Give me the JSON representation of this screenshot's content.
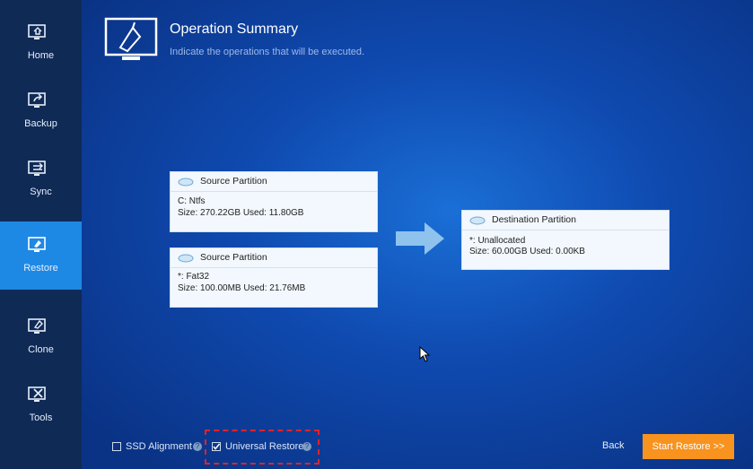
{
  "sidebar": {
    "items": [
      {
        "label": "Home",
        "icon": "home-icon",
        "active": false
      },
      {
        "label": "Backup",
        "icon": "backup-icon",
        "active": false
      },
      {
        "label": "Sync",
        "icon": "sync-icon",
        "active": false
      },
      {
        "label": "Restore",
        "icon": "restore-icon",
        "active": true
      },
      {
        "label": "Clone",
        "icon": "clone-icon",
        "active": false
      },
      {
        "label": "Tools",
        "icon": "tools-icon",
        "active": false
      }
    ]
  },
  "header": {
    "title": "Operation Summary",
    "subtitle": "Indicate the operations that will be executed."
  },
  "sources": [
    {
      "header": "Source Partition",
      "name": "C: Ntfs",
      "size": "Size: 270.22GB  Used: 11.80GB"
    },
    {
      "header": "Source Partition",
      "name": "*: Fat32",
      "size": "Size: 100.00MB  Used: 21.76MB"
    }
  ],
  "destination": {
    "header": "Destination Partition",
    "name": "*: Unallocated",
    "size": "Size: 60.00GB  Used: 0.00KB"
  },
  "options": {
    "ssd_alignment": {
      "label": "SSD Alignment",
      "checked": false
    },
    "universal_restore": {
      "label": "Universal Restore",
      "checked": true
    }
  },
  "footer": {
    "back_label": "Back",
    "start_label": "Start Restore >>"
  },
  "colors": {
    "sidebar_bg": "#0f2a55",
    "active_item": "#1e88e5",
    "start_button": "#f7931e",
    "highlight_border": "#e0232b"
  }
}
